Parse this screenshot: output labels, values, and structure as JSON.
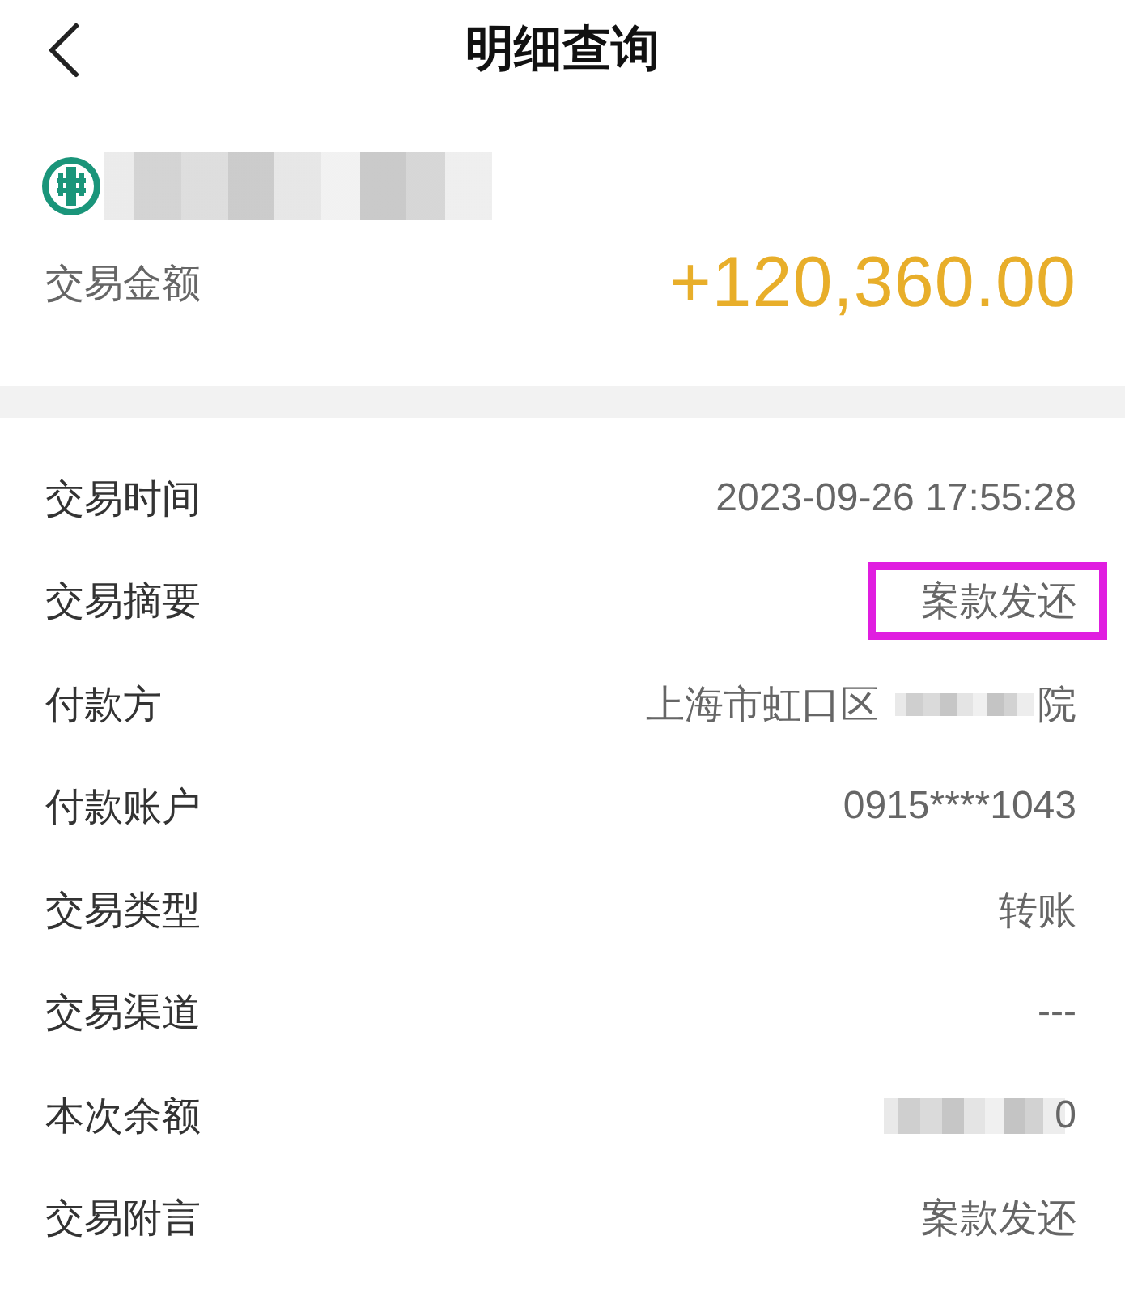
{
  "nav": {
    "title": "明细查询"
  },
  "account": {
    "name_blurred": true
  },
  "amount": {
    "label": "交易金额",
    "value": "+120,360.00"
  },
  "details": [
    {
      "label": "交易时间",
      "highlighted": false,
      "value": [
        {
          "kind": "text",
          "text": "2023-09-26 17:55:28"
        }
      ]
    },
    {
      "label": "交易摘要",
      "highlighted": true,
      "value": [
        {
          "kind": "text",
          "text": "案款发还"
        }
      ]
    },
    {
      "label": "付款方",
      "highlighted": false,
      "value": [
        {
          "kind": "text",
          "text": "上海市虹口区"
        },
        {
          "kind": "blur"
        },
        {
          "kind": "text",
          "text": "院"
        }
      ]
    },
    {
      "label": "付款账户",
      "highlighted": false,
      "value": [
        {
          "kind": "text",
          "text": "0915****1043"
        }
      ]
    },
    {
      "label": "交易类型",
      "highlighted": false,
      "value": [
        {
          "kind": "text",
          "text": "转账"
        }
      ]
    },
    {
      "label": "交易渠道",
      "highlighted": false,
      "value": [
        {
          "kind": "text",
          "text": "---"
        }
      ]
    },
    {
      "label": "本次余额",
      "highlighted": false,
      "value": [
        {
          "kind": "wide_blur"
        },
        {
          "kind": "text",
          "text": "0"
        }
      ]
    },
    {
      "label": "交易附言",
      "highlighted": false,
      "value": [
        {
          "kind": "text",
          "text": "案款发还"
        }
      ]
    }
  ]
}
